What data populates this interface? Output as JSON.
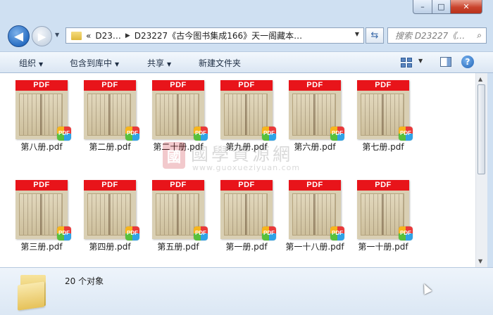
{
  "window": {
    "controls": {
      "minimize": "–",
      "maximize": "□",
      "close": "✕"
    }
  },
  "nav": {
    "back_icon": "◀",
    "forward_icon": "▶",
    "history_dropdown": "▼",
    "address": {
      "overflow": "«",
      "segment1": "D23…",
      "separator": "▶",
      "segment2": "D23227《古今图书集成166》天一阁藏本…",
      "dropdown": "▼"
    },
    "refresh_icon": "⇆",
    "search": {
      "placeholder": "搜索 D23227《…",
      "icon": "⌕"
    }
  },
  "toolbar": {
    "organize": "组织",
    "include_library": "包含到库中",
    "share": "共享",
    "new_folder": "新建文件夹",
    "dropdown_arrow": "▼",
    "help_icon": "?"
  },
  "files": [
    {
      "name": "第八册.pdf"
    },
    {
      "name": "第二册.pdf"
    },
    {
      "name": "第二十册.pdf"
    },
    {
      "name": "第九册.pdf"
    },
    {
      "name": "第六册.pdf"
    },
    {
      "name": "第七册.pdf"
    },
    {
      "name": "第三册.pdf"
    },
    {
      "name": "第四册.pdf"
    },
    {
      "name": "第五册.pdf"
    },
    {
      "name": "第一册.pdf"
    },
    {
      "name": "第一十八册.pdf"
    },
    {
      "name": "第一十册.pdf"
    }
  ],
  "thumbnail": {
    "band_label": "PDF",
    "badge_label": "PDF"
  },
  "watermark": {
    "seal": "國",
    "title": "國學資源網",
    "url": "www.guoxueziyuan.com"
  },
  "status": {
    "count_text": "20 个对象"
  },
  "scrollbar": {
    "up": "▲",
    "down": "▼"
  },
  "colors": {
    "pdf_red": "#e8141a",
    "window_frame": "#cfe0f2",
    "close_button": "#c9432c"
  }
}
